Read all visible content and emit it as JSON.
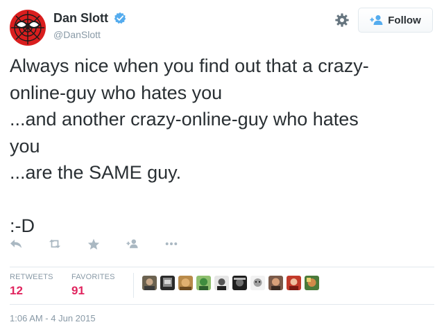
{
  "author": {
    "name": "Dan Slott",
    "handle": "@DanSlott",
    "verified": true,
    "avatar_icon": "spider-man-mask-icon"
  },
  "header": {
    "settings_icon": "gear-icon",
    "follow_label": "Follow",
    "follow_icon": "add-user-icon"
  },
  "tweet": {
    "text": "Always nice when you find out that a crazy-\nonline-guy who hates you\n...and another crazy-online-guy who hates\nyou\n...are the SAME guy.\n\n:-D"
  },
  "actions": [
    {
      "name": "reply",
      "icon": "reply-icon"
    },
    {
      "name": "retweet",
      "icon": "retweet-icon"
    },
    {
      "name": "favorite",
      "icon": "star-icon"
    },
    {
      "name": "follow",
      "icon": "add-user-icon"
    },
    {
      "name": "more",
      "icon": "more-icon"
    }
  ],
  "stats": {
    "retweets_label": "RETWEETS",
    "retweets_value": "12",
    "favorites_label": "FAVORITES",
    "favorites_value": "91"
  },
  "favorited_by_count": 10,
  "timestamp": "1:06 AM - 4 Jun 2015",
  "colors": {
    "text": "#292f33",
    "muted": "#8899a6",
    "accent": "#55acee",
    "stat_value": "#e0245e",
    "border": "#e1e8ed"
  }
}
